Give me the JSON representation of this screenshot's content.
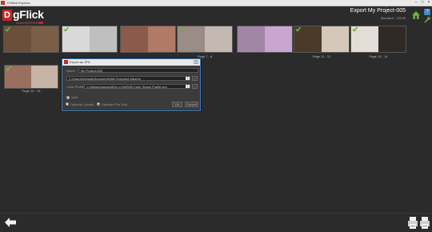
{
  "window": {
    "title": "DGflick Express"
  },
  "header": {
    "logo_letter": "D",
    "logo_word": "gFlick",
    "logo_sub": "ALBUMXPRESS",
    "project_title": "Export My Project-005",
    "project_sub": "Standard - 15X30",
    "help_glyph": "?"
  },
  "thumbnails": [
    {
      "label": "",
      "left_color": "#6b4f3a",
      "right_color": "#7a5e48",
      "checked": true
    },
    {
      "label": "",
      "left_color": "#d9d9d9",
      "right_color": "#bfbfbf",
      "checked": true
    },
    {
      "label": "",
      "left_color": "#8c5a4a",
      "right_color": "#b07a66",
      "checked": false
    },
    {
      "label": "Page 7 - 8",
      "left_color": "#9a8c86",
      "right_color": "#c4b8b2",
      "checked": true
    },
    {
      "label": "",
      "left_color": "#a385a8",
      "right_color": "#c9a6cf",
      "checked": false
    },
    {
      "label": "Page 11 - 12",
      "left_color": "#4a3a2a",
      "right_color": "#d6c8b8",
      "checked": true
    },
    {
      "label": "Page 13 - 14",
      "left_color": "#e2ddd6",
      "right_color": "#2f2a26",
      "checked": true
    },
    {
      "label": "Page 15 - 16",
      "left_color": "#9a6f60",
      "right_color": "#c8b4a4",
      "checked": true
    }
  ],
  "dialog": {
    "title": "Export as JPG",
    "close_glyph": "x",
    "name_label": "Name",
    "name_value": "My Project-005",
    "path_value": "C:\\Users\\Deepak\\Documents\\My Exported Albums",
    "path_button": "...",
    "color_profile_label": "Color Profile",
    "color_profile_value": "C:\\Album\\gmpwrMG\\x-4.0\\sRGB Color Space Profile.icm",
    "split_label": "Split",
    "optimize_quality_label": "Optimize Quality",
    "optimize_size_label": "Optimize File Size",
    "ok_label": "Ok",
    "cancel_label": "Cancel",
    "arrow_glyph": "▾"
  },
  "icons": {
    "back": "back-arrow-icon",
    "home": "home-icon",
    "settings": "settings-icon",
    "export": "export-printer-icon"
  },
  "colors": {
    "accent": "#c62828",
    "dialog_border": "#3a7fc1",
    "check": "#6ab04c"
  }
}
